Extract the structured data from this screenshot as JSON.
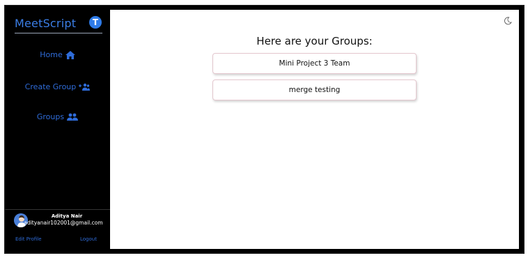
{
  "sidebar": {
    "brand": {
      "title": "MeetScript",
      "badge_letter": "T"
    },
    "nav": [
      {
        "label": "Home",
        "icon": "home-icon"
      },
      {
        "label": "Create Group",
        "icon": "add-users-icon"
      },
      {
        "label": "Groups",
        "icon": "users-icon"
      }
    ],
    "user": {
      "name": "Aditya Nair",
      "email": "adityanair102001@gmail.com",
      "avatar_icon": "avatar-icon"
    },
    "links": {
      "edit_profile": "Edit Profile",
      "logout": "Logout"
    }
  },
  "main": {
    "title": "Here are your Groups:",
    "theme_icon": "moon-icon",
    "groups": [
      {
        "name": "Mini Project 3 Team"
      },
      {
        "name": "merge testing"
      }
    ]
  },
  "colors": {
    "accent": "#2f6cd9",
    "sidebar_bg": "#000000",
    "main_bg": "#ffffff",
    "card_border": "#e4c7ce"
  }
}
